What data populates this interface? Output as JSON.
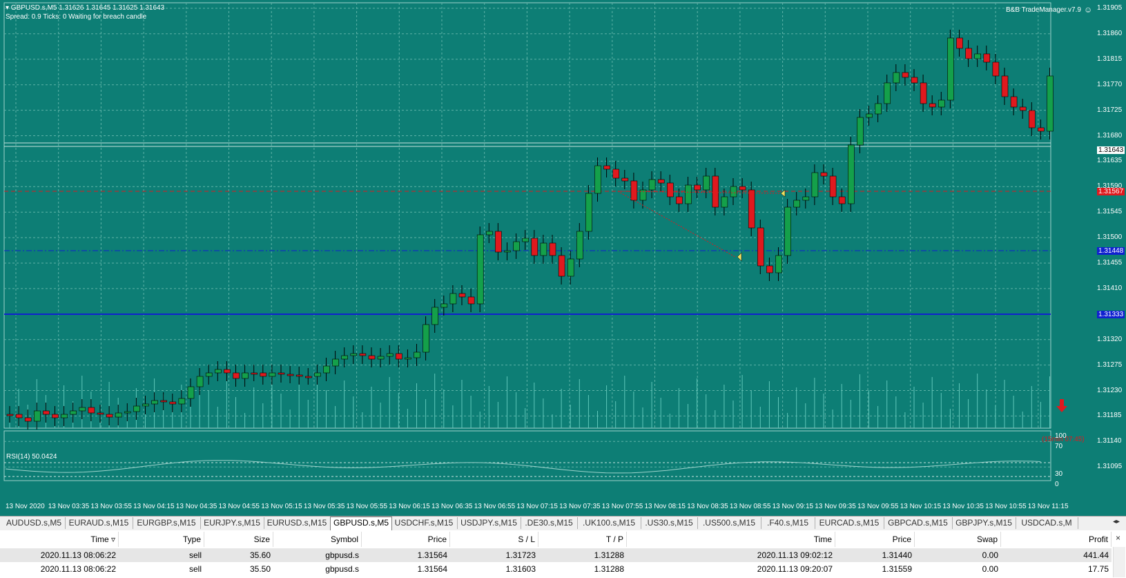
{
  "chart": {
    "header_line1": "GBPUSD.s,M5  1.31626 1.31645 1.31625 1.31643",
    "header_line2": "Spread: 0.9  Ticks: 0  Waiting for breach candle",
    "trade_manager": "B&B TradeManager.v7.9",
    "countdown": "(15min 07:45)",
    "rsi_label": "RSI(14) 50.0424",
    "colors": {
      "background": "#0d7e75",
      "bull": "#14a04a",
      "bear": "#e0191e",
      "blue_line": "#1020d0"
    },
    "price_labels": [
      "1.31905",
      "1.31860",
      "1.31815",
      "1.31770",
      "1.31725",
      "1.31680",
      "1.31635",
      "1.31590",
      "1.31545",
      "1.31500",
      "1.31455",
      "1.31410",
      "1.31365",
      "1.31320",
      "1.31275",
      "1.31230",
      "1.31185",
      "1.31140",
      "1.31095"
    ],
    "price_boxes": {
      "current": "1.31643",
      "red": "1.31567",
      "blue_dash": "1.31448",
      "blue_solid": "1.31333"
    },
    "rsi_levels": [
      "100",
      "70",
      "30",
      "0"
    ],
    "time_labels": [
      "13 Nov 2020",
      "13 Nov 03:35",
      "13 Nov 03:55",
      "13 Nov 04:15",
      "13 Nov 04:35",
      "13 Nov 04:55",
      "13 Nov 05:15",
      "13 Nov 05:35",
      "13 Nov 05:55",
      "13 Nov 06:15",
      "13 Nov 06:35",
      "13 Nov 06:55",
      "13 Nov 07:15",
      "13 Nov 07:35",
      "13 Nov 07:55",
      "13 Nov 08:15",
      "13 Nov 08:35",
      "13 Nov 08:55",
      "13 Nov 09:15",
      "13 Nov 09:35",
      "13 Nov 09:55",
      "13 Nov 10:15",
      "13 Nov 10:35",
      "13 Nov 10:55",
      "13 Nov 11:15"
    ]
  },
  "tabs": [
    "AUDUSD.s,M5",
    "EURAUD.s,M15",
    "EURGBP.s,M15",
    "EURJPY.s,M15",
    "EURUSD.s,M15",
    "GBPUSD.s,M5",
    "USDCHF.s,M15",
    "USDJPY.s,M15",
    ".DE30.s,M15",
    ".UK100.s,M15",
    ".US30.s,M15",
    ".US500.s,M15",
    ".F40.s,M15",
    "EURCAD.s,M15",
    "GBPCAD.s,M15",
    "GBPJPY.s,M15",
    "USDCAD.s,M"
  ],
  "active_tab": "GBPUSD.s,M5",
  "table": {
    "headers": [
      "Time",
      "Type",
      "Size",
      "Symbol",
      "Price",
      "S / L",
      "T / P",
      "Time",
      "Price",
      "Swap",
      "Profit"
    ],
    "rows": [
      [
        "2020.11.13 08:06:22",
        "sell",
        "35.60",
        "gbpusd.s",
        "1.31564",
        "1.31723",
        "1.31288",
        "2020.11.13 09:02:12",
        "1.31440",
        "0.00",
        "441.44"
      ],
      [
        "2020.11.13 08:06:22",
        "sell",
        "35.50",
        "gbpusd.s",
        "1.31564",
        "1.31603",
        "1.31288",
        "2020.11.13 09:20:07",
        "1.31559",
        "0.00",
        "17.75"
      ]
    ]
  }
}
